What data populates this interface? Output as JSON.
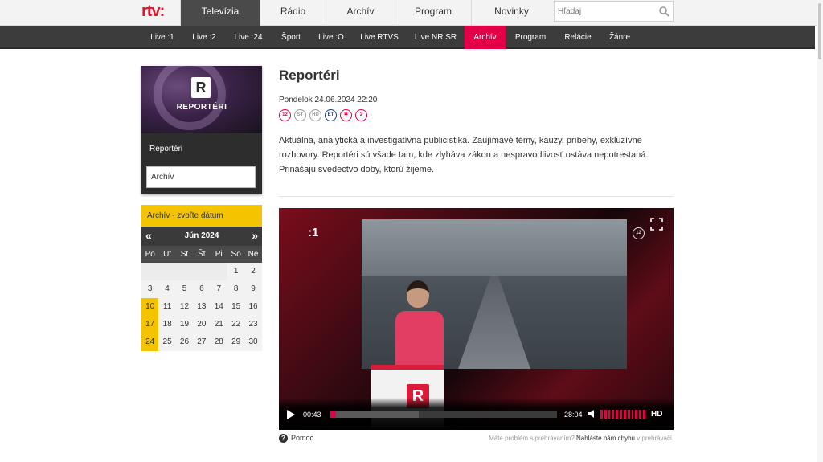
{
  "brand": {
    "logo_text": "rtv:"
  },
  "main_nav": {
    "items": [
      "Televízia",
      "Rádio",
      "Archív",
      "Program",
      "Novinky"
    ],
    "active": "Televízia"
  },
  "search": {
    "placeholder": "Hľadaj"
  },
  "sub_nav": {
    "items": [
      "Live :1",
      "Live :2",
      "Live :24",
      "Šport",
      "Live :O",
      "Live RTVS",
      "Live NR SR",
      "Archív",
      "Program",
      "Relácie",
      "Žánre"
    ],
    "active": "Archív"
  },
  "sidebar": {
    "show_title": "REPORTÉRI",
    "logo_letter": "R",
    "link_show": "Reportéri",
    "link_archive": "Archív"
  },
  "calendar": {
    "header": "Archív - zvoľte dátum",
    "prev": "«",
    "next": "»",
    "month": "Jún 2024",
    "weekdays": [
      "Po",
      "Ut",
      "St",
      "Št",
      "Pi",
      "So",
      "Ne"
    ],
    "weeks": [
      [
        "",
        "",
        "",
        "",
        "",
        "1",
        "2"
      ],
      [
        "3",
        "4",
        "5",
        "6",
        "7",
        "8",
        "9"
      ],
      [
        "10",
        "11",
        "12",
        "13",
        "14",
        "15",
        "16"
      ],
      [
        "17",
        "18",
        "19",
        "20",
        "21",
        "22",
        "23"
      ],
      [
        "24",
        "25",
        "26",
        "27",
        "28",
        "29",
        "30"
      ]
    ],
    "highlighted": [
      "10",
      "17",
      "24"
    ]
  },
  "program": {
    "title": "Reportéri",
    "datetime": "Pondelok 24.06.2024 22:20",
    "badges": [
      "12",
      "ST",
      "HD",
      "ET",
      "✱",
      "2"
    ],
    "description": "Aktuálna, analytická a investigatívna publicistika. Zaujímavé témy, kauzy, príbehy, exkluzívne rozhovory. Reportéri sú všade tam, kde zlyháva zákon a nespravodlivosť ostáva nepotrestaná. Prinášajú svedectvo doby, ktorú žijeme."
  },
  "player": {
    "channel_logo": ":1",
    "age_rating": "12",
    "current_time": "00:43",
    "duration": "28:04",
    "progress_fraction": 0.026,
    "buffered_fraction": 0.39,
    "volume_bars": 12,
    "quality": "HD",
    "desk_letter": "R"
  },
  "footer": {
    "help": "Pomoc",
    "help_icon": "?",
    "report_prefix": "Máte problém s prehrávaním?",
    "report_link": "Nahláste nám chybu",
    "report_suffix": "v prehrávači."
  },
  "colors": {
    "accent": "#e40046",
    "brand_red": "#e2162a",
    "calendar_yellow": "#f5c400",
    "nav_dark": "#3c3c3c"
  }
}
